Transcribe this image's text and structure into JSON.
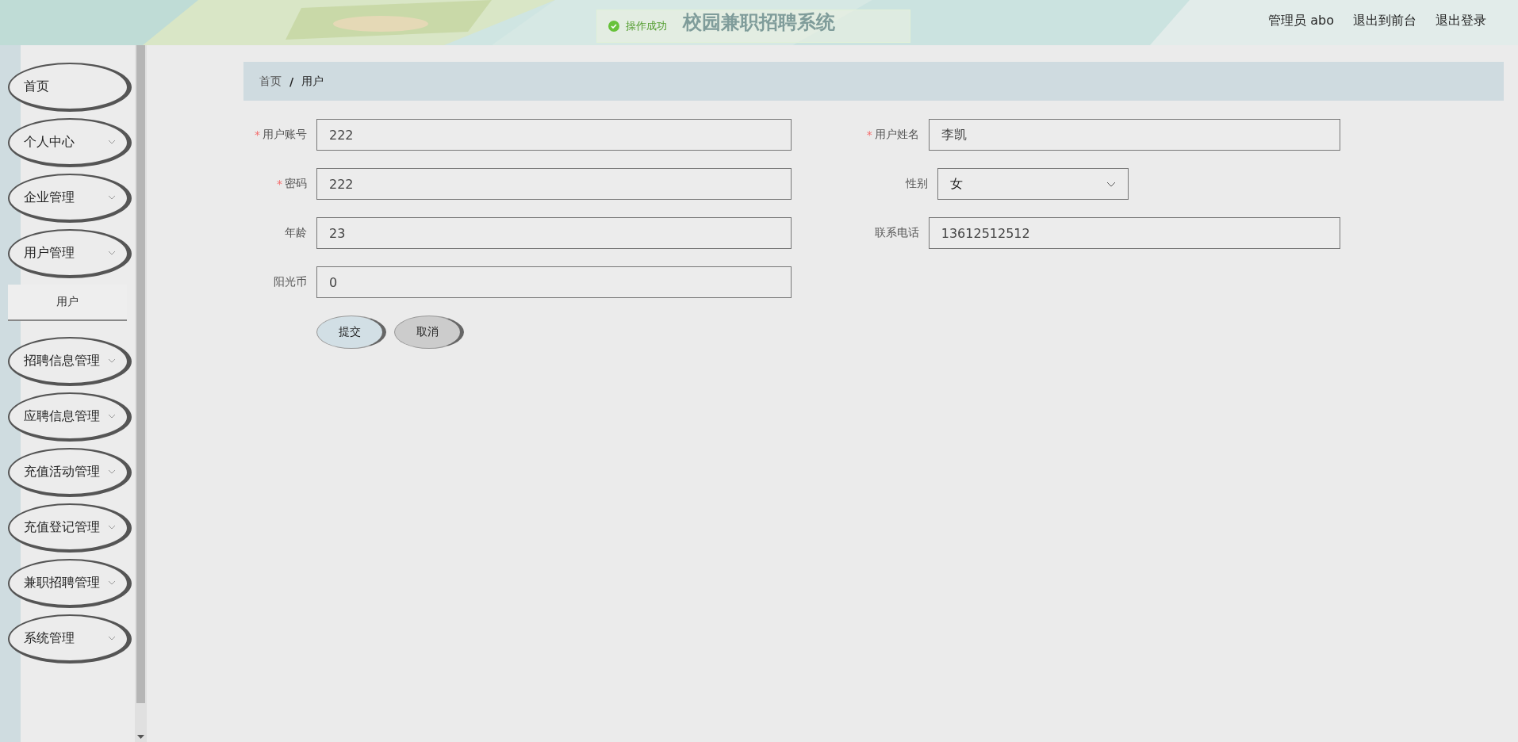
{
  "header": {
    "title": "校园兼职招聘系统",
    "toast": "操作成功",
    "links": [
      {
        "label": "管理员 abo"
      },
      {
        "label": "退出到前台"
      },
      {
        "label": "退出登录"
      }
    ]
  },
  "sidebar": {
    "items": [
      {
        "label": "首页",
        "kind": "link"
      },
      {
        "label": "个人中心",
        "kind": "menu"
      },
      {
        "label": "企业管理",
        "kind": "menu"
      },
      {
        "label": "用户管理",
        "kind": "menu",
        "children": [
          {
            "label": "用户"
          }
        ]
      },
      {
        "label": "招聘信息管理",
        "kind": "menu"
      },
      {
        "label": "应聘信息管理",
        "kind": "menu"
      },
      {
        "label": "充值活动管理",
        "kind": "menu"
      },
      {
        "label": "充值登记管理",
        "kind": "menu"
      },
      {
        "label": "兼职招聘管理",
        "kind": "menu"
      },
      {
        "label": "系统管理",
        "kind": "menu"
      }
    ]
  },
  "breadcrumb": [
    {
      "label": "首页"
    },
    {
      "separator": "/",
      "label": "用户"
    }
  ],
  "form": {
    "fields": [
      {
        "required_mark": "*",
        "label": "用户账号",
        "kind": "text",
        "value": "222"
      },
      {
        "required_mark": "*",
        "label": "用户姓名",
        "kind": "text",
        "value": "李凯"
      },
      {
        "required_mark": "*",
        "label": "密码",
        "kind": "text",
        "value": "222"
      },
      {
        "label": "性别",
        "kind": "select",
        "value": "女"
      },
      {
        "label": "年龄",
        "kind": "text",
        "value": "23"
      },
      {
        "label": "联系电话",
        "kind": "text",
        "value": "13612512512"
      },
      {
        "label": "阳光币",
        "kind": "text",
        "value": "0"
      }
    ],
    "buttons": [
      {
        "label": "提交",
        "kind": "primary"
      },
      {
        "label": "取消",
        "kind": "secondary"
      }
    ]
  }
}
